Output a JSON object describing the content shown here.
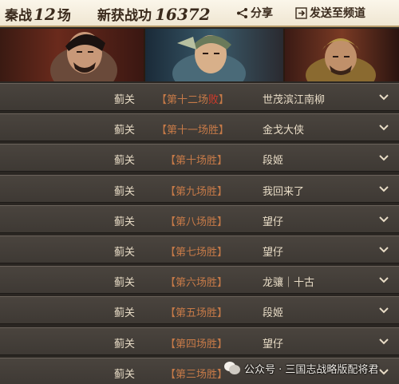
{
  "header": {
    "battles_label": "秦战",
    "battles_count": "12",
    "battles_unit": "场",
    "merit_label": "新获战功",
    "merit_value": "16372",
    "share_label": "分享",
    "send_label": "发送至频道"
  },
  "rows": [
    {
      "pass": "蓟关",
      "round": "【第十二场",
      "result": "败",
      "result_type": "lose",
      "round_end": "】",
      "player": "世茂滨江南柳"
    },
    {
      "pass": "蓟关",
      "round": "【第十一场",
      "result": "胜",
      "result_type": "win",
      "round_end": "】",
      "player": "金戈大侠"
    },
    {
      "pass": "蓟关",
      "round": "【第十场",
      "result": "胜",
      "result_type": "win",
      "round_end": "】",
      "player": "段姬"
    },
    {
      "pass": "蓟关",
      "round": "【第九场",
      "result": "胜",
      "result_type": "win",
      "round_end": "】",
      "player": "我回来了"
    },
    {
      "pass": "蓟关",
      "round": "【第八场",
      "result": "胜",
      "result_type": "win",
      "round_end": "】",
      "player": "望仔"
    },
    {
      "pass": "蓟关",
      "round": "【第七场",
      "result": "胜",
      "result_type": "win",
      "round_end": "】",
      "player": "望仔"
    },
    {
      "pass": "蓟关",
      "round": "【第六场",
      "result": "胜",
      "result_type": "win",
      "round_end": "】",
      "player": "龙骧｜十古"
    },
    {
      "pass": "蓟关",
      "round": "【第五场",
      "result": "胜",
      "result_type": "win",
      "round_end": "】",
      "player": "段姬"
    },
    {
      "pass": "蓟关",
      "round": "【第四场",
      "result": "胜",
      "result_type": "win",
      "round_end": "】",
      "player": "望仔"
    },
    {
      "pass": "蓟关",
      "round": "【第三场",
      "result": "胜",
      "result_type": "win",
      "round_end": "】",
      "player": ""
    }
  ],
  "watermark": {
    "text": "公众号 · 三国志战略版配将君"
  },
  "colors": {
    "header_bg": "#f4eddc",
    "row_bg": "#433e38",
    "text_light": "#e8dcc6",
    "accent_orange": "#c67a48",
    "lose_red": "#d23a2a"
  }
}
